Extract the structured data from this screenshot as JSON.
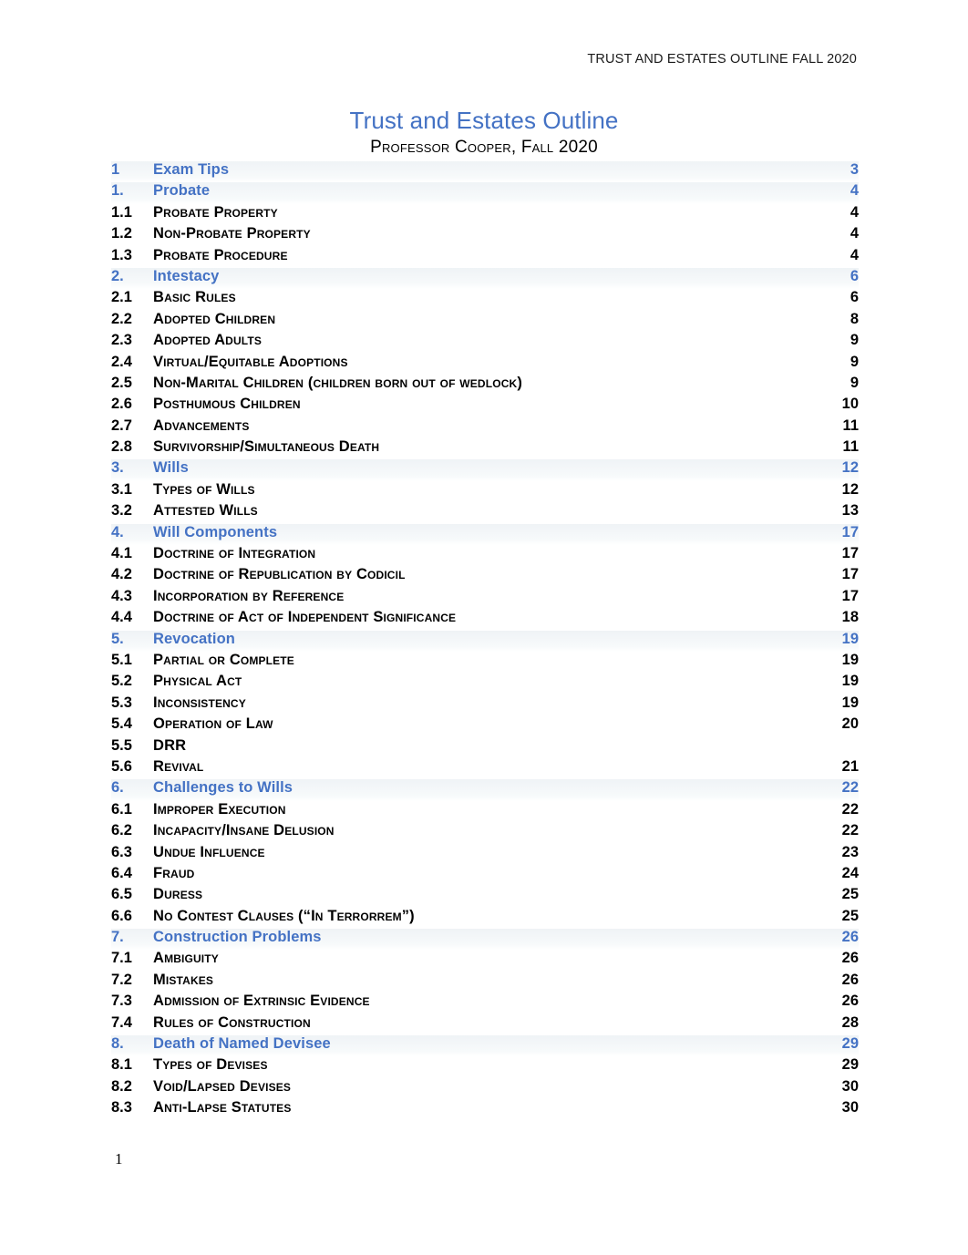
{
  "header": {
    "running_head": "TRUST AND ESTATES OUTLINE FALL 2020"
  },
  "title_block": {
    "title": "Trust and Estates Outline",
    "subtitle": "Professor Cooper, Fall 2020"
  },
  "colors": {
    "accent_blue": "#4472C4",
    "level1_band": "#F2F5F7",
    "body_text": "#000000"
  },
  "footer": {
    "page_number": "1"
  },
  "toc": {
    "entries": [
      {
        "level": 1,
        "number": "1",
        "label": "Exam Tips",
        "page": "3"
      },
      {
        "level": 1,
        "number": "1.",
        "label": "Probate",
        "page": "4"
      },
      {
        "level": 2,
        "number": "1.1",
        "label": "Probate Property",
        "page": "4"
      },
      {
        "level": 2,
        "number": "1.2",
        "label": "Non-Probate Property",
        "page": "4"
      },
      {
        "level": 2,
        "number": "1.3",
        "label": "Probate Procedure",
        "page": "4"
      },
      {
        "level": 1,
        "number": "2.",
        "label": "Intestacy",
        "page": "6"
      },
      {
        "level": 2,
        "number": "2.1",
        "label": "Basic Rules",
        "page": "6"
      },
      {
        "level": 2,
        "number": "2.2",
        "label": "Adopted Children",
        "page": "8"
      },
      {
        "level": 2,
        "number": "2.3",
        "label": "Adopted Adults",
        "page": "9"
      },
      {
        "level": 2,
        "number": "2.4",
        "label": "Virtual/Equitable Adoptions",
        "page": "9"
      },
      {
        "level": 2,
        "number": "2.5",
        "label": "Non-Marital Children (children born out of wedlock)",
        "page": "9"
      },
      {
        "level": 2,
        "number": "2.6",
        "label": "Posthumous Children",
        "page": "10"
      },
      {
        "level": 2,
        "number": "2.7",
        "label": "Advancements",
        "page": "11"
      },
      {
        "level": 2,
        "number": "2.8",
        "label": "Survivorship/Simultaneous Death",
        "page": "11"
      },
      {
        "level": 1,
        "number": "3.",
        "label": "Wills",
        "page": "12"
      },
      {
        "level": 2,
        "number": "3.1",
        "label": "Types of Wills",
        "page": "12"
      },
      {
        "level": 2,
        "number": "3.2",
        "label": "Attested Wills",
        "page": "13"
      },
      {
        "level": 1,
        "number": "4.",
        "label": "Will Components",
        "page": "17"
      },
      {
        "level": 2,
        "number": "4.1",
        "label": "Doctrine of Integration",
        "page": "17"
      },
      {
        "level": 2,
        "number": "4.2",
        "label": "Doctrine of Republication by Codicil",
        "page": "17"
      },
      {
        "level": 2,
        "number": "4.3",
        "label": "Incorporation by Reference",
        "page": "17"
      },
      {
        "level": 2,
        "number": "4.4",
        "label": "Doctrine of Act of Independent Significance",
        "page": "18"
      },
      {
        "level": 1,
        "number": "5.",
        "label": "Revocation",
        "page": "19"
      },
      {
        "level": 2,
        "number": "5.1",
        "label": "Partial or Complete",
        "page": "19"
      },
      {
        "level": 2,
        "number": "5.2",
        "label": "Physical Act",
        "page": "19"
      },
      {
        "level": 2,
        "number": "5.3",
        "label": "Inconsistency",
        "page": "19"
      },
      {
        "level": 2,
        "number": "5.4",
        "label": "Operation of Law",
        "page": "20"
      },
      {
        "level": 2,
        "number": "5.5",
        "label": "DRR",
        "page": ""
      },
      {
        "level": 2,
        "number": "5.6",
        "label": "Revival",
        "page": "21"
      },
      {
        "level": 1,
        "number": "6.",
        "label": "Challenges to Wills",
        "page": "22"
      },
      {
        "level": 2,
        "number": "6.1",
        "label": "Improper Execution",
        "page": "22"
      },
      {
        "level": 2,
        "number": "6.2",
        "label": "Incapacity/Insane Delusion",
        "page": "22"
      },
      {
        "level": 2,
        "number": "6.3",
        "label": "Undue Influence",
        "page": "23"
      },
      {
        "level": 2,
        "number": "6.4",
        "label": "Fraud",
        "page": "24"
      },
      {
        "level": 2,
        "number": "6.5",
        "label": "Duress",
        "page": "25"
      },
      {
        "level": 2,
        "number": "6.6",
        "label": "No Contest Clauses (“In Terrorrem”)",
        "page": "25"
      },
      {
        "level": 1,
        "number": "7.",
        "label": "Construction Problems",
        "page": "26"
      },
      {
        "level": 2,
        "number": "7.1",
        "label": "Ambiguity",
        "page": "26"
      },
      {
        "level": 2,
        "number": "7.2",
        "label": "Mistakes",
        "page": "26"
      },
      {
        "level": 2,
        "number": "7.3",
        "label": "Admission of Extrinsic Evidence",
        "page": "26"
      },
      {
        "level": 2,
        "number": "7.4",
        "label": "Rules of Construction",
        "page": "28"
      },
      {
        "level": 1,
        "number": "8.",
        "label": "Death of Named Devisee",
        "page": "29"
      },
      {
        "level": 2,
        "number": "8.1",
        "label": "Types of Devises",
        "page": "29"
      },
      {
        "level": 2,
        "number": "8.2",
        "label": "Void/Lapsed Devises",
        "page": "30"
      },
      {
        "level": 2,
        "number": "8.3",
        "label": "Anti-Lapse Statutes",
        "page": "30"
      }
    ]
  }
}
